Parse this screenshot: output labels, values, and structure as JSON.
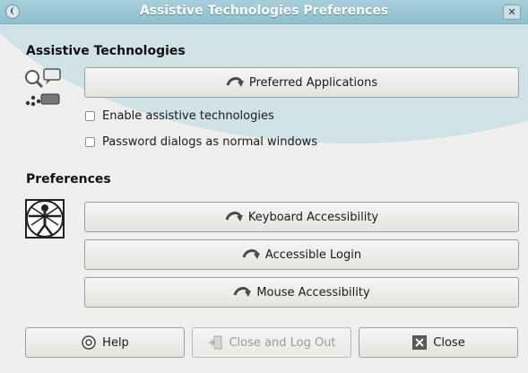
{
  "window": {
    "title": "Assistive Technologies Preferences",
    "menu_glyph": "❨",
    "close_glyph": "✕"
  },
  "assistive": {
    "heading": "Assistive Technologies",
    "preferred_apps_label": "Preferred Applications",
    "enable_at_label": "Enable assistive technologies",
    "enable_at_checked": false,
    "password_dialogs_label": "Password dialogs as normal windows",
    "password_dialogs_checked": false
  },
  "preferences": {
    "heading": "Preferences",
    "keyboard_label": "Keyboard Accessibility",
    "login_label": "Accessible Login",
    "mouse_label": "Mouse Accessibility"
  },
  "footer": {
    "help_label": "Help",
    "close_logout_label": "Close and Log Out",
    "close_logout_enabled": false,
    "close_label": "Close"
  },
  "colors": {
    "titlebar": "#9fc8d4",
    "accent_swoosh": "#cfe2e6",
    "window_bg": "#efefed"
  }
}
